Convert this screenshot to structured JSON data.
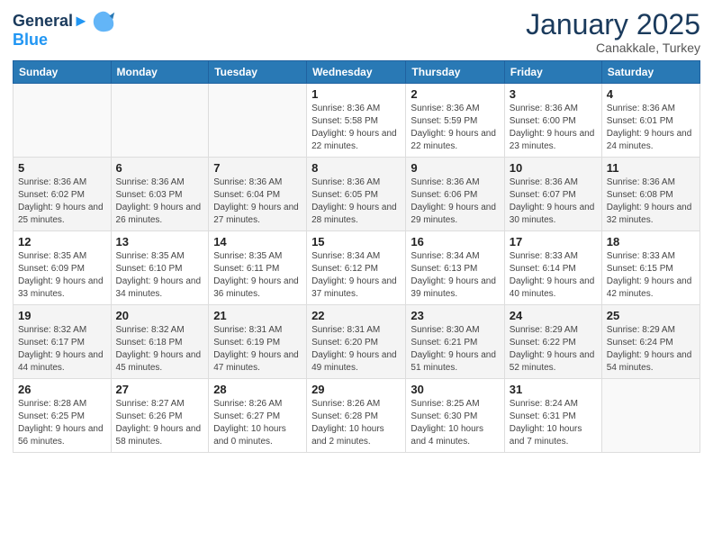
{
  "logo": {
    "line1": "General",
    "line2": "Blue"
  },
  "title": "January 2025",
  "location": "Canakkale, Turkey",
  "weekdays": [
    "Sunday",
    "Monday",
    "Tuesday",
    "Wednesday",
    "Thursday",
    "Friday",
    "Saturday"
  ],
  "weeks": [
    [
      {
        "day": "",
        "info": ""
      },
      {
        "day": "",
        "info": ""
      },
      {
        "day": "",
        "info": ""
      },
      {
        "day": "1",
        "info": "Sunrise: 8:36 AM\nSunset: 5:58 PM\nDaylight: 9 hours\nand 22 minutes."
      },
      {
        "day": "2",
        "info": "Sunrise: 8:36 AM\nSunset: 5:59 PM\nDaylight: 9 hours\nand 22 minutes."
      },
      {
        "day": "3",
        "info": "Sunrise: 8:36 AM\nSunset: 6:00 PM\nDaylight: 9 hours\nand 23 minutes."
      },
      {
        "day": "4",
        "info": "Sunrise: 8:36 AM\nSunset: 6:01 PM\nDaylight: 9 hours\nand 24 minutes."
      }
    ],
    [
      {
        "day": "5",
        "info": "Sunrise: 8:36 AM\nSunset: 6:02 PM\nDaylight: 9 hours\nand 25 minutes."
      },
      {
        "day": "6",
        "info": "Sunrise: 8:36 AM\nSunset: 6:03 PM\nDaylight: 9 hours\nand 26 minutes."
      },
      {
        "day": "7",
        "info": "Sunrise: 8:36 AM\nSunset: 6:04 PM\nDaylight: 9 hours\nand 27 minutes."
      },
      {
        "day": "8",
        "info": "Sunrise: 8:36 AM\nSunset: 6:05 PM\nDaylight: 9 hours\nand 28 minutes."
      },
      {
        "day": "9",
        "info": "Sunrise: 8:36 AM\nSunset: 6:06 PM\nDaylight: 9 hours\nand 29 minutes."
      },
      {
        "day": "10",
        "info": "Sunrise: 8:36 AM\nSunset: 6:07 PM\nDaylight: 9 hours\nand 30 minutes."
      },
      {
        "day": "11",
        "info": "Sunrise: 8:36 AM\nSunset: 6:08 PM\nDaylight: 9 hours\nand 32 minutes."
      }
    ],
    [
      {
        "day": "12",
        "info": "Sunrise: 8:35 AM\nSunset: 6:09 PM\nDaylight: 9 hours\nand 33 minutes."
      },
      {
        "day": "13",
        "info": "Sunrise: 8:35 AM\nSunset: 6:10 PM\nDaylight: 9 hours\nand 34 minutes."
      },
      {
        "day": "14",
        "info": "Sunrise: 8:35 AM\nSunset: 6:11 PM\nDaylight: 9 hours\nand 36 minutes."
      },
      {
        "day": "15",
        "info": "Sunrise: 8:34 AM\nSunset: 6:12 PM\nDaylight: 9 hours\nand 37 minutes."
      },
      {
        "day": "16",
        "info": "Sunrise: 8:34 AM\nSunset: 6:13 PM\nDaylight: 9 hours\nand 39 minutes."
      },
      {
        "day": "17",
        "info": "Sunrise: 8:33 AM\nSunset: 6:14 PM\nDaylight: 9 hours\nand 40 minutes."
      },
      {
        "day": "18",
        "info": "Sunrise: 8:33 AM\nSunset: 6:15 PM\nDaylight: 9 hours\nand 42 minutes."
      }
    ],
    [
      {
        "day": "19",
        "info": "Sunrise: 8:32 AM\nSunset: 6:17 PM\nDaylight: 9 hours\nand 44 minutes."
      },
      {
        "day": "20",
        "info": "Sunrise: 8:32 AM\nSunset: 6:18 PM\nDaylight: 9 hours\nand 45 minutes."
      },
      {
        "day": "21",
        "info": "Sunrise: 8:31 AM\nSunset: 6:19 PM\nDaylight: 9 hours\nand 47 minutes."
      },
      {
        "day": "22",
        "info": "Sunrise: 8:31 AM\nSunset: 6:20 PM\nDaylight: 9 hours\nand 49 minutes."
      },
      {
        "day": "23",
        "info": "Sunrise: 8:30 AM\nSunset: 6:21 PM\nDaylight: 9 hours\nand 51 minutes."
      },
      {
        "day": "24",
        "info": "Sunrise: 8:29 AM\nSunset: 6:22 PM\nDaylight: 9 hours\nand 52 minutes."
      },
      {
        "day": "25",
        "info": "Sunrise: 8:29 AM\nSunset: 6:24 PM\nDaylight: 9 hours\nand 54 minutes."
      }
    ],
    [
      {
        "day": "26",
        "info": "Sunrise: 8:28 AM\nSunset: 6:25 PM\nDaylight: 9 hours\nand 56 minutes."
      },
      {
        "day": "27",
        "info": "Sunrise: 8:27 AM\nSunset: 6:26 PM\nDaylight: 9 hours\nand 58 minutes."
      },
      {
        "day": "28",
        "info": "Sunrise: 8:26 AM\nSunset: 6:27 PM\nDaylight: 10 hours\nand 0 minutes."
      },
      {
        "day": "29",
        "info": "Sunrise: 8:26 AM\nSunset: 6:28 PM\nDaylight: 10 hours\nand 2 minutes."
      },
      {
        "day": "30",
        "info": "Sunrise: 8:25 AM\nSunset: 6:30 PM\nDaylight: 10 hours\nand 4 minutes."
      },
      {
        "day": "31",
        "info": "Sunrise: 8:24 AM\nSunset: 6:31 PM\nDaylight: 10 hours\nand 7 minutes."
      },
      {
        "day": "",
        "info": ""
      }
    ]
  ]
}
